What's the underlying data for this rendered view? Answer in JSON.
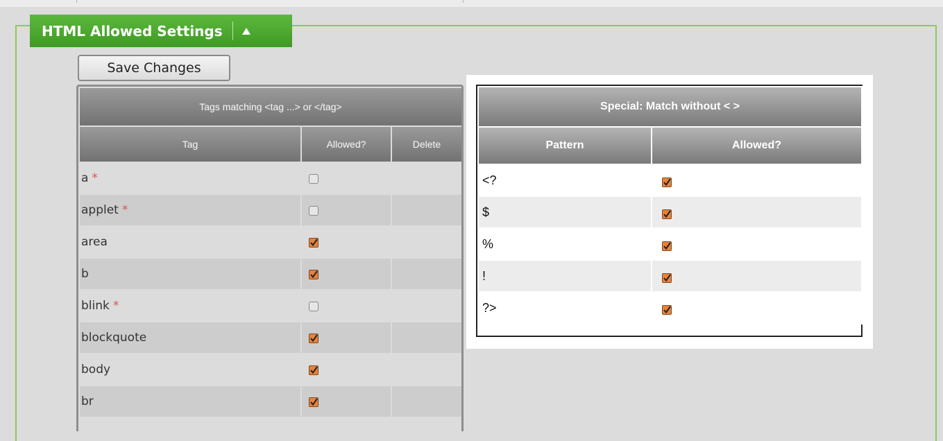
{
  "section": {
    "title": "HTML Allowed Settings",
    "toggle_icon": "collapse-up-icon"
  },
  "toolbar": {
    "save_label": "Save Changes"
  },
  "tags_table": {
    "caption": "Tags matching <tag ...> or </tag>",
    "columns": [
      "Tag",
      "Allowed?",
      "Delete"
    ],
    "rows": [
      {
        "tag": "a",
        "required": true,
        "allowed": false
      },
      {
        "tag": "applet",
        "required": true,
        "allowed": false
      },
      {
        "tag": "area",
        "required": false,
        "allowed": true
      },
      {
        "tag": "b",
        "required": false,
        "allowed": true
      },
      {
        "tag": "blink",
        "required": true,
        "allowed": false
      },
      {
        "tag": "blockquote",
        "required": false,
        "allowed": true
      },
      {
        "tag": "body",
        "required": false,
        "allowed": true
      },
      {
        "tag": "br",
        "required": false,
        "allowed": true
      }
    ],
    "required_marker": "*"
  },
  "special_table": {
    "caption": "Special: Match without < >",
    "columns": [
      "Pattern",
      "Allowed?"
    ],
    "rows": [
      {
        "pattern": "<?",
        "allowed": true
      },
      {
        "pattern": "$",
        "allowed": true
      },
      {
        "pattern": "%",
        "allowed": true
      },
      {
        "pattern": "!",
        "allowed": true
      },
      {
        "pattern": "?>",
        "allowed": true
      }
    ]
  },
  "colors": {
    "accent_green": "#4aa82e",
    "checkbox_checked": "#e8823a",
    "header_gray": "#808080"
  }
}
